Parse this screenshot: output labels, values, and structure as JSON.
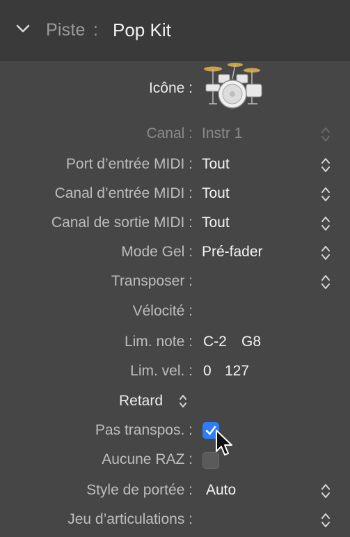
{
  "header": {
    "label": "Piste",
    "separator": ":",
    "track_name": "Pop Kit",
    "chevron_icon": "chevron-down-icon"
  },
  "rows": {
    "icone": {
      "label": "Icône :",
      "icon": "drum-kit-icon"
    },
    "canal": {
      "label": "Canal :",
      "value": "Instr 1"
    },
    "port_entree": {
      "label": "Port d’entrée MIDI :",
      "value": "Tout"
    },
    "canal_entree": {
      "label": "Canal d’entrée MIDI :",
      "value": "Tout"
    },
    "canal_sortie": {
      "label": "Canal de sortie MIDI :",
      "value": "Tout"
    },
    "mode_gel": {
      "label": "Mode Gel :",
      "value": "Pré-fader"
    },
    "transposer": {
      "label": "Transposer :",
      "value": ""
    },
    "velocite": {
      "label": "Vélocité :",
      "value": ""
    },
    "lim_note": {
      "label": "Lim. note :",
      "low": "C-2",
      "high": "G8"
    },
    "lim_vel": {
      "label": "Lim. vel. :",
      "low": "0",
      "high": "127"
    },
    "retard": {
      "label": "Retard"
    },
    "pas_transpos": {
      "label": "Pas transpos. :",
      "checked": true
    },
    "aucune_raz": {
      "label": "Aucune RAZ :",
      "checked": false
    },
    "style_portee": {
      "label": "Style de portée :",
      "value": "Auto"
    },
    "jeu_articulations": {
      "label": "Jeu d’articulations :",
      "value": ""
    }
  },
  "colors": {
    "checkbox_accent": "#2e7cf6",
    "background": "#464646",
    "header_background": "#3a3a3a"
  }
}
